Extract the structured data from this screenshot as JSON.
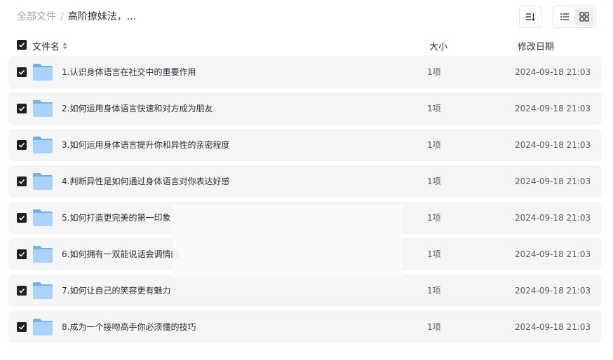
{
  "breadcrumb": {
    "root": "全部文件",
    "separator": "/",
    "current": "高阶撩妹法，..."
  },
  "toolbar": {
    "sort_icon": "sort-icon",
    "list_view_icon": "list-view-icon",
    "grid_view_icon": "grid-view-icon",
    "active_view": "list"
  },
  "table": {
    "columns": {
      "name": "文件名",
      "size": "大小",
      "modified": "修改日期"
    },
    "rows": [
      {
        "name": "1.认识身体语言在社交中的重要作用",
        "size": "1项",
        "modified": "2024-09-18 21:03"
      },
      {
        "name": "2.如何运用身体语言快速和对方成为朋友",
        "size": "1项",
        "modified": "2024-09-18 21:03"
      },
      {
        "name": "3.如何运用身体语言提升你和异性的亲密程度",
        "size": "1项",
        "modified": "2024-09-18 21:03"
      },
      {
        "name": "4.判断异性是如何通过身体语言对你表达好感",
        "size": "1项",
        "modified": "2024-09-18 21:03"
      },
      {
        "name": "5.如何打造更完美的第一印象",
        "size": "1项",
        "modified": "2024-09-18 21:03"
      },
      {
        "name": "6.如何拥有一双能说话会调情的",
        "size": "1项",
        "modified": "2024-09-18 21:03"
      },
      {
        "name": "7.如何让自己的笑容更有魅力",
        "size": "1项",
        "modified": "2024-09-18 21:03"
      },
      {
        "name": "8.成为一个接吻高手你必须懂的技巧",
        "size": "1项",
        "modified": "2024-09-18 21:03"
      }
    ]
  },
  "colors": {
    "folder_light": "#a9d3fb",
    "folder_dark": "#6fb2f2",
    "checkbox": "#1f1f1f",
    "row_bg": "#f5f5f6"
  }
}
